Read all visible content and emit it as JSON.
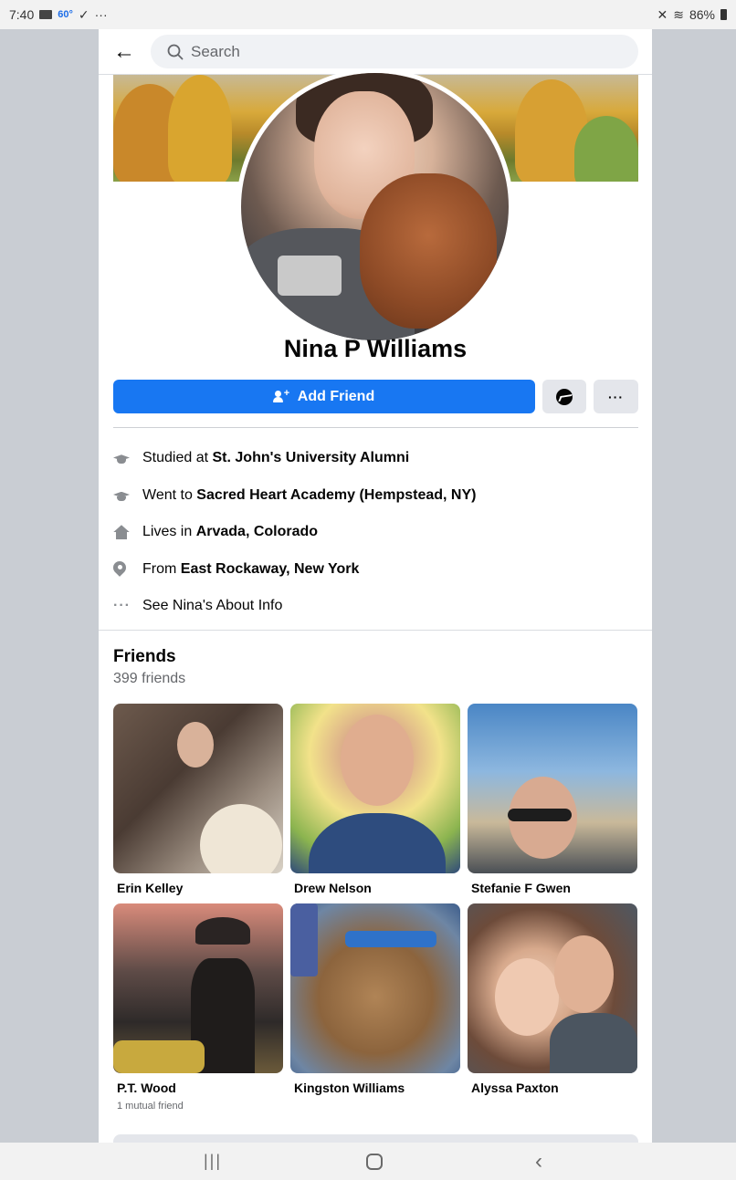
{
  "status_bar": {
    "time": "7:40",
    "temp": "60°",
    "battery": "86%"
  },
  "search": {
    "placeholder": "Search"
  },
  "profile": {
    "name": "Nina P Williams",
    "add_friend_label": "Add Friend",
    "more_label": "···"
  },
  "info": [
    {
      "icon": "graduation-cap-icon",
      "prefix": "Studied at ",
      "bold": "St. John's University Alumni"
    },
    {
      "icon": "graduation-cap-icon",
      "prefix": "Went to ",
      "bold": "Sacred Heart Academy (Hempstead, NY)"
    },
    {
      "icon": "home-icon",
      "prefix": "Lives in ",
      "bold": "Arvada, Colorado"
    },
    {
      "icon": "location-pin-icon",
      "prefix": "From ",
      "bold": "East Rockaway, New York"
    },
    {
      "icon": "more-dots-icon",
      "prefix": "See Nina's About Info",
      "bold": ""
    }
  ],
  "friends": {
    "title": "Friends",
    "count": "399 friends",
    "list": [
      {
        "name": "Erin Kelley",
        "mutual": ""
      },
      {
        "name": "Drew Nelson",
        "mutual": ""
      },
      {
        "name": "Stefanie F Gwen",
        "mutual": ""
      },
      {
        "name": "P.T. Wood",
        "mutual": "1 mutual friend"
      },
      {
        "name": "Kingston Williams",
        "mutual": ""
      },
      {
        "name": "Alyssa Paxton",
        "mutual": ""
      }
    ]
  },
  "colors": {
    "accent": "#1877f2",
    "secondary_button": "#e4e6eb",
    "text_secondary": "#65676b"
  }
}
